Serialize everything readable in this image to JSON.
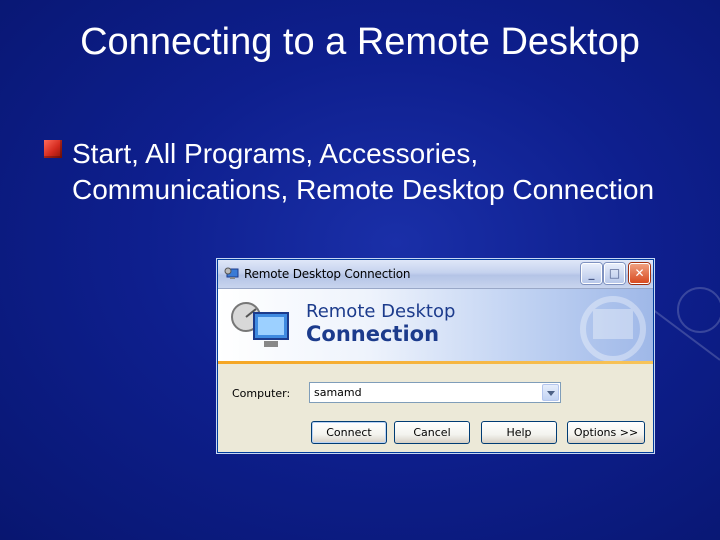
{
  "slide": {
    "title": "Connecting to a Remote Desktop",
    "bullet": "Start, All Programs, Accessories, Communications, Remote Desktop Connection"
  },
  "window": {
    "title": "Remote Desktop Connection",
    "banner_line1": "Remote Desktop",
    "banner_line2": "Connection",
    "computer_label": "Computer:",
    "computer_value": "samamd",
    "buttons": {
      "connect": "Connect",
      "cancel": "Cancel",
      "help": "Help",
      "options": "Options >>"
    },
    "controls": {
      "minimize": "_",
      "maximize": "□",
      "close": "✕"
    }
  },
  "icons": {
    "bullet": "red-square-bullet-icon",
    "app": "remote-desktop-icon",
    "combo": "chevron-down-icon"
  },
  "colors": {
    "background": "#0e1f8e",
    "bullet": "#d42a1e",
    "window_border": "#003c9c",
    "banner_text": "#1c3b8c",
    "accent_stripe": "#f5a623"
  }
}
